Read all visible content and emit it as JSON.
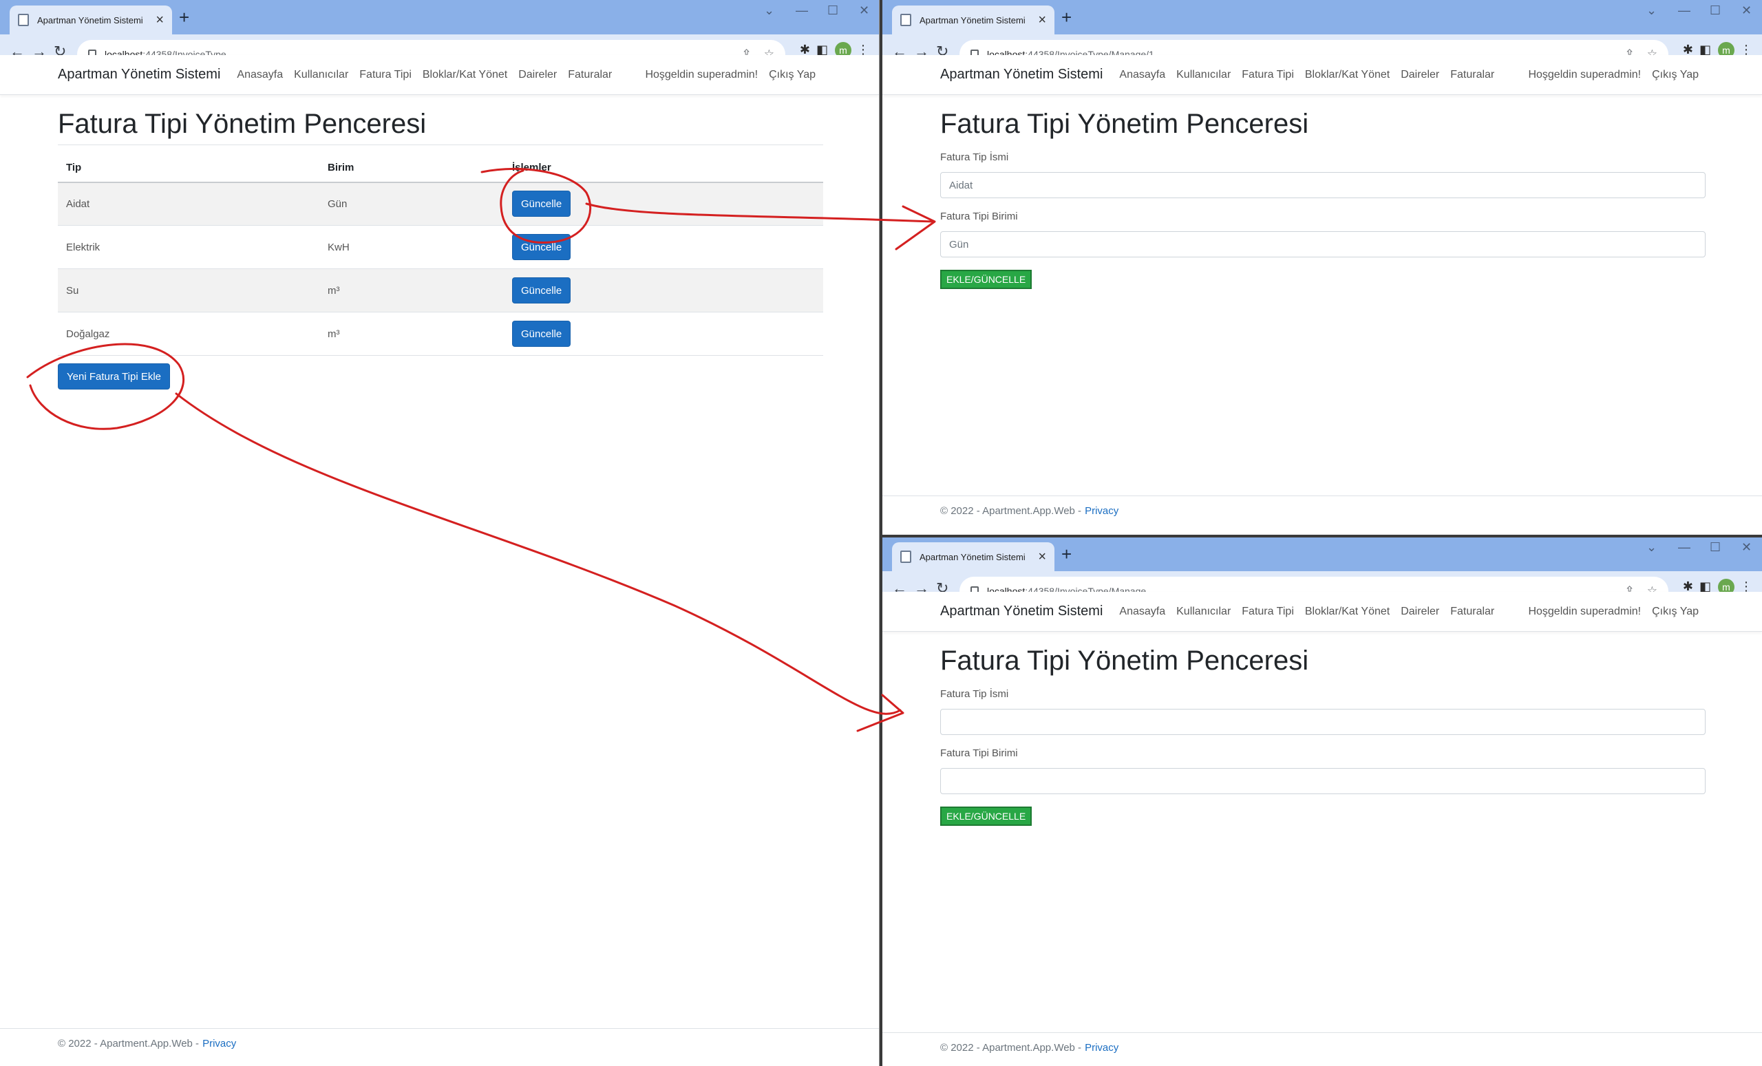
{
  "browser": {
    "tab_title": "Apartman Yönetim Sistemi",
    "tab_close": "×",
    "new_tab": "+",
    "window_controls": [
      "⌄",
      "—",
      "☐",
      "✕"
    ],
    "url_host": "localhost",
    "url_left_path": ":44358/InvoiceType",
    "url_tr_path": ":44358/InvoiceType/Manage/1",
    "url_br_path": ":44358/InvoiceType/Manage",
    "avatar_letter": "m",
    "icons": [
      "back-arrow-icon",
      "forward-arrow-icon",
      "reload-icon",
      "lock-icon",
      "share-icon",
      "star-icon",
      "extensions-icon",
      "side-panel-icon",
      "menu-icon"
    ]
  },
  "navbar": {
    "brand": "Apartman Yönetim Sistemi",
    "links": [
      "Anasayfa",
      "Kullanıcılar",
      "Fatura Tipi",
      "Bloklar/Kat Yönet",
      "Daireler",
      "Faturalar"
    ],
    "greeting": "Hoşgeldin superadmin!",
    "logout": "Çıkış Yap"
  },
  "list_page": {
    "title": "Fatura Tipi Yönetim Penceresi",
    "columns": [
      "Tip",
      "Birim",
      "İşlemler"
    ],
    "rows": [
      {
        "tip": "Aidat",
        "birim": "Gün",
        "action": "Güncelle"
      },
      {
        "tip": "Elektrik",
        "birim": "KwH",
        "action": "Güncelle"
      },
      {
        "tip": "Su",
        "birim": "m³",
        "action": "Güncelle"
      },
      {
        "tip": "Doğalgaz",
        "birim": "m³",
        "action": "Güncelle"
      }
    ],
    "add_button": "Yeni Fatura Tipi Ekle"
  },
  "edit_page": {
    "title": "Fatura Tipi Yönetim Penceresi",
    "name_label": "Fatura Tip İsmi",
    "name_value": "Aidat",
    "unit_label": "Fatura Tipi Birimi",
    "unit_value": "Gün",
    "submit": "EKLE/GÜNCELLE"
  },
  "new_page": {
    "title": "Fatura Tipi Yönetim Penceresi",
    "name_label": "Fatura Tip İsmi",
    "name_value": "",
    "unit_label": "Fatura Tipi Birimi",
    "unit_value": "",
    "submit": "EKLE/GÜNCELLE"
  },
  "footer": {
    "text": "© 2022 - Apartment.App.Web -",
    "link": "Privacy"
  },
  "colors": {
    "primary_button": "#1b6ec2",
    "submit_button": "#28a745",
    "annotation": "#d42020",
    "tab_strip": "#8ab0e8"
  }
}
